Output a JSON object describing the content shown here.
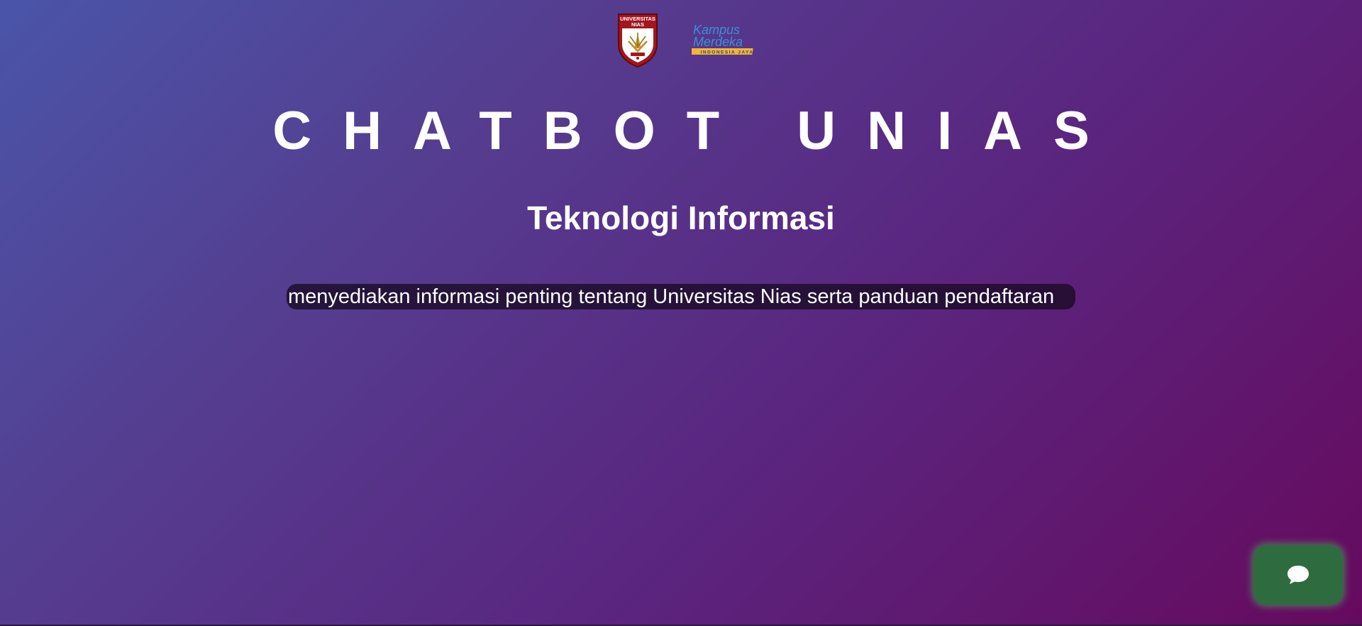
{
  "header": {
    "logo_unias_line1": "UNIVERSITAS",
    "logo_unias_line2": "NIAS",
    "logo_merdeka_line1": "Kampus",
    "logo_merdeka_line2": "Merdeka",
    "logo_merdeka_tagline": "INDONESIA JAYA"
  },
  "main": {
    "title": "CHATBOT UNIAS",
    "subtitle": "Teknologi Informasi",
    "marquee": "menyediakan informasi penting tentang Universitas Nias serta panduan pendaftaran"
  },
  "chat_widget": {
    "icon": "chat-bubble-icon",
    "color": "#2e6b3f",
    "glow": "#44be5a"
  },
  "colors": {
    "gradient_start": "#4a55a9",
    "gradient_end": "#660a5e",
    "unias_red": "#a3161c"
  }
}
